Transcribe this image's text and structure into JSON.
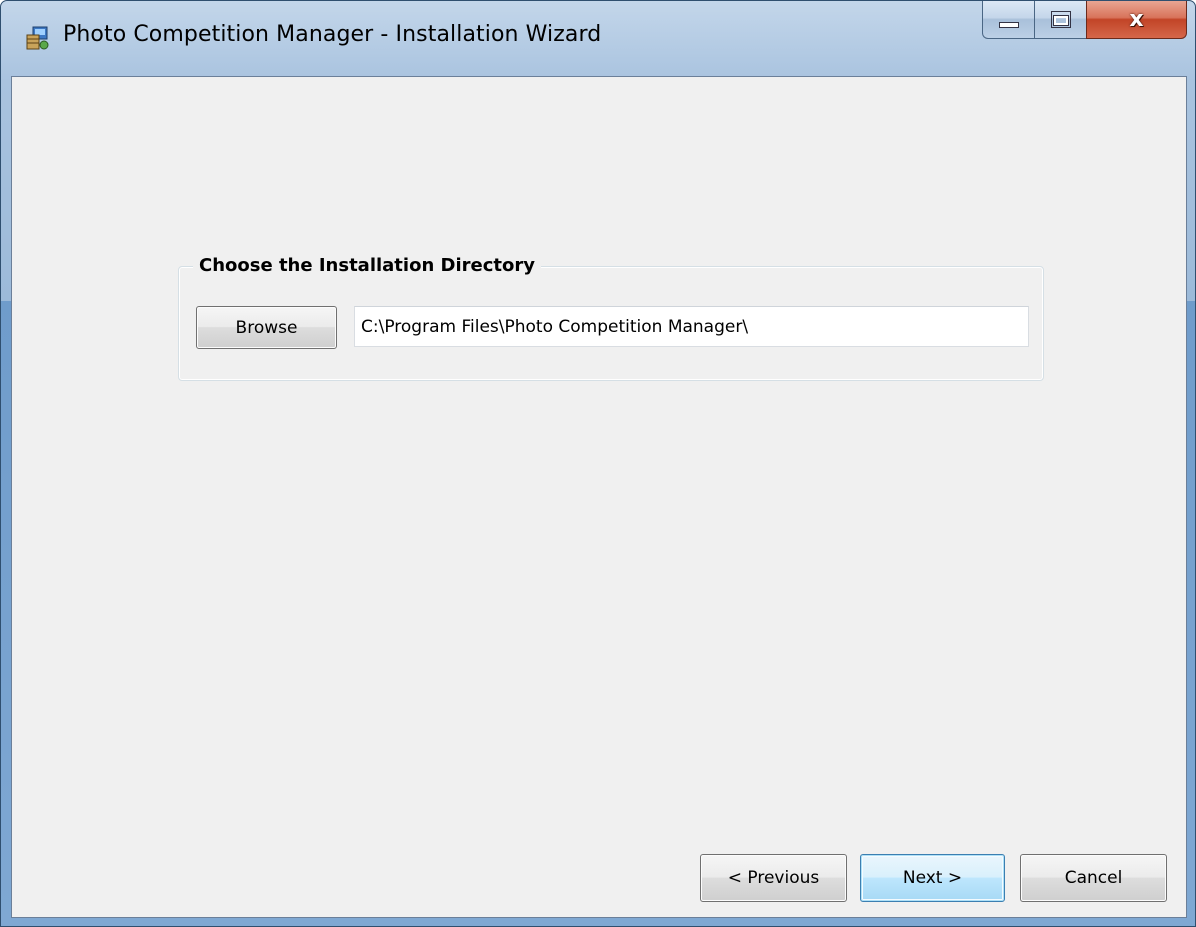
{
  "window": {
    "title": "Photo Competition Manager - Installation Wizard",
    "minimize_icon": "minimize-icon",
    "maximize_icon": "maximize-icon",
    "close_glyph": "x"
  },
  "directory_group": {
    "legend": "Choose the Installation Directory",
    "browse_label": "Browse",
    "path_value": "C:\\Program Files\\Photo Competition Manager\\"
  },
  "nav": {
    "previous_label": "< Previous",
    "next_label": "Next >",
    "cancel_label": "Cancel"
  },
  "colors": {
    "client_background": "#f0f0f0",
    "close_button": "#c24427",
    "default_button_border": "#3c7fb1"
  }
}
